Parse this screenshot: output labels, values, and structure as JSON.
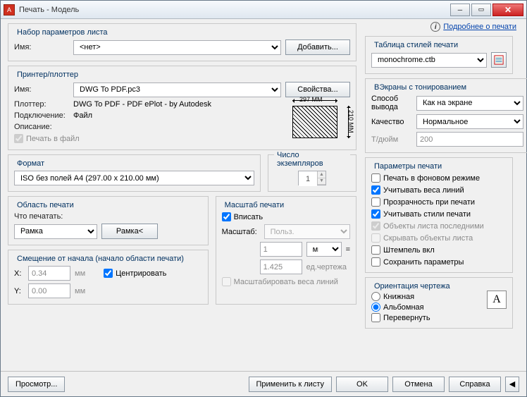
{
  "window": {
    "title": "Печать - Модель"
  },
  "moreLink": "Подробнее о печати",
  "pageSetup": {
    "legend": "Набор параметров листа",
    "nameLabel": "Имя:",
    "nameValue": "<нет>",
    "addBtn": "Добавить..."
  },
  "printer": {
    "legend": "Принтер/плоттер",
    "nameLabel": "Имя:",
    "nameValue": "DWG To PDF.pc3",
    "propsBtn": "Свойства...",
    "plotterLabel": "Плоттер:",
    "plotterValue": "DWG To PDF - PDF ePlot - by Autodesk",
    "connLabel": "Подключение:",
    "connValue": "Файл",
    "descLabel": "Описание:",
    "descValue": "",
    "printToFile": "Печать в файл",
    "previewW": "297 MM",
    "previewH": "210 MM"
  },
  "format": {
    "legend": "Формат",
    "value": "ISO без полей A4 (297.00 x 210.00 мм)"
  },
  "copies": {
    "legend": "Число экземпляров",
    "value": "1"
  },
  "area": {
    "legend": "Область печати",
    "whatLabel": "Что печатать:",
    "whatValue": "Рамка",
    "frameBtn": "Рамка<"
  },
  "scale": {
    "legend": "Масштаб печати",
    "fit": "Вписать",
    "scaleLabel": "Масштаб:",
    "scaleValue": "Польз.",
    "num": "1",
    "unit": "мм",
    "den": "1.425",
    "denUnit": "ед.чертежа",
    "scaleLw": "Масштабировать веса линий"
  },
  "offset": {
    "legend": "Смещение от начала (начало области печати)",
    "xLabel": "X:",
    "xValue": "0.34",
    "xUnit": "мм",
    "yLabel": "Y:",
    "yValue": "0.00",
    "yUnit": "мм",
    "center": "Центрировать"
  },
  "styles": {
    "legend": "Таблица стилей печати",
    "value": "monochrome.ctb"
  },
  "shaded": {
    "legend": "ВЭкраны с тонированием",
    "modeLabel": "Способ вывода",
    "modeValue": "Как на экране",
    "qualityLabel": "Качество",
    "qualityValue": "Нормальное",
    "dpiLabel": "Т/дюйм",
    "dpiValue": "200"
  },
  "options": {
    "legend": "Параметры печати",
    "bg": "Печать в фоновом режиме",
    "lw": "Учитывать веса линий",
    "tr": "Прозрачность при печати",
    "ps": "Учитывать стили печати",
    "last": "Объекты листа последними",
    "hide": "Скрывать объекты листа",
    "stamp": "Штемпель вкл",
    "save": "Сохранить параметры"
  },
  "orient": {
    "legend": "Ориентация чертежа",
    "portrait": "Книжная",
    "landscape": "Альбомная",
    "upside": "Перевернуть"
  },
  "footer": {
    "preview": "Просмотр...",
    "apply": "Применить к листу",
    "ok": "OK",
    "cancel": "Отмена",
    "help": "Справка"
  }
}
